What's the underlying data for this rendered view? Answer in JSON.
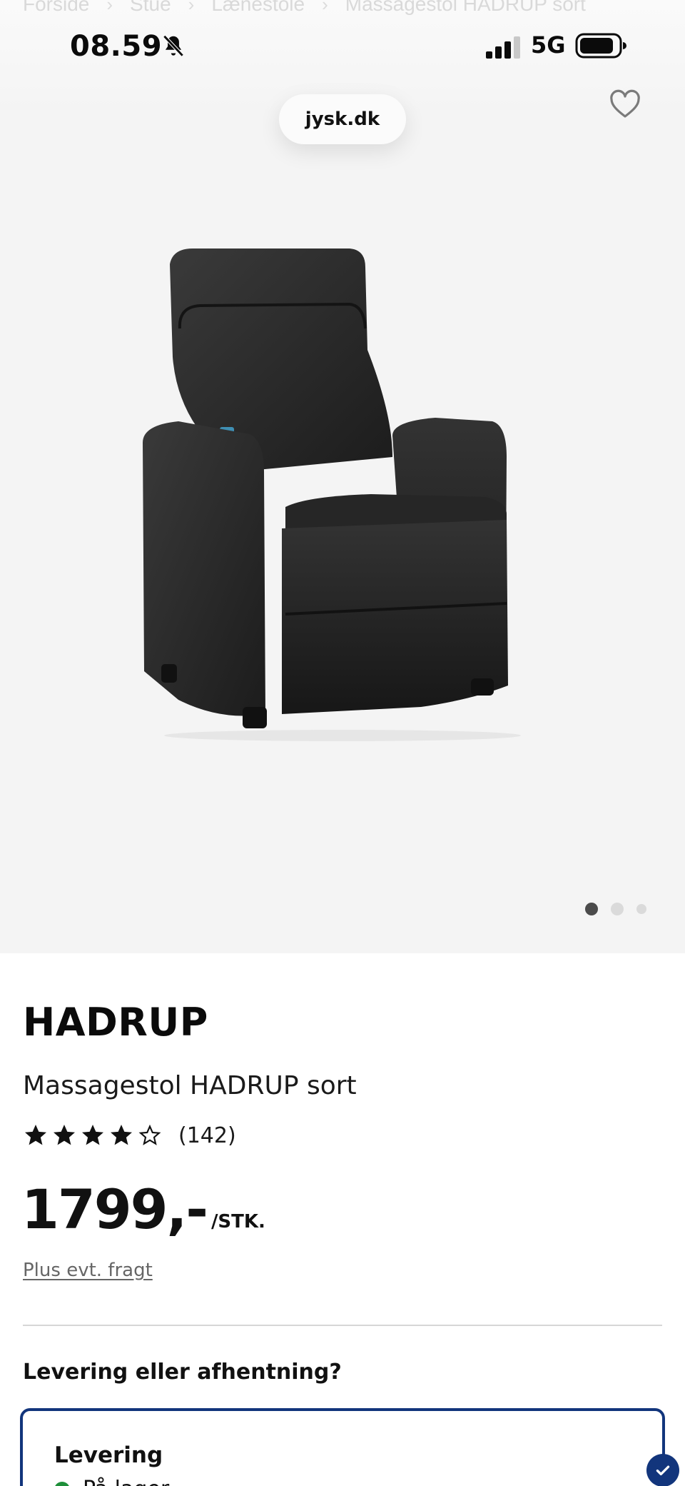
{
  "breadcrumb": [
    "Forside",
    "Stue",
    "Lænestole",
    "Massagestol HADRUP sort"
  ],
  "status_bar": {
    "time": "08.59",
    "network": "5G",
    "signal_bars": 3,
    "muted": true
  },
  "browser": {
    "url": "jysk.dk"
  },
  "gallery": {
    "image_count": 3,
    "active_index": 0
  },
  "product": {
    "brand": "HADRUP",
    "name": "Massagestol HADRUP sort",
    "rating": 4,
    "rating_max": 5,
    "review_count": "(142)",
    "price": "1799,-",
    "unit": "/STK.",
    "freight_link": "Plus evt. fragt"
  },
  "delivery": {
    "heading": "Levering eller afhentning?",
    "option_title": "Levering",
    "stock_status": "På lager",
    "selected": true
  },
  "colors": {
    "accent": "#12357c",
    "in_stock": "#1e8f3a",
    "image_bg": "#f4f4f4"
  },
  "icons": [
    "bell-slash-icon",
    "signal-icon",
    "battery-icon",
    "heart-icon",
    "star-icon",
    "checkmark-icon"
  ]
}
